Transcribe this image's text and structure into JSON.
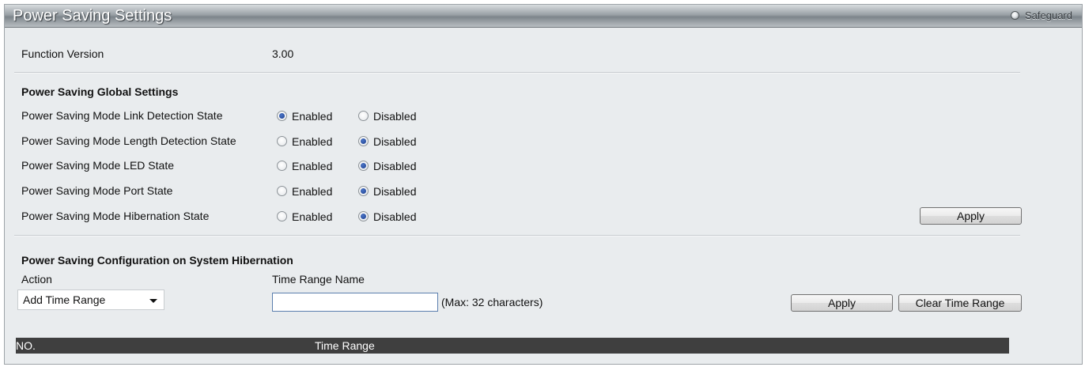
{
  "header": {
    "title": "Power Saving Settings",
    "safeguard_label": "Safeguard"
  },
  "function_version": {
    "label": "Function Version",
    "value": "3.00"
  },
  "global_settings": {
    "heading": "Power Saving Global Settings",
    "enabled_label": "Enabled",
    "disabled_label": "Disabled",
    "rows": [
      {
        "label": "Power Saving Mode Link Detection State",
        "selected": "Enabled"
      },
      {
        "label": "Power Saving Mode Length Detection State",
        "selected": "Disabled"
      },
      {
        "label": "Power Saving Mode LED State",
        "selected": "Disabled"
      },
      {
        "label": "Power Saving Mode Port State",
        "selected": "Disabled"
      },
      {
        "label": "Power Saving Mode Hibernation State",
        "selected": "Disabled"
      }
    ],
    "apply_label": "Apply"
  },
  "hibernation": {
    "heading": "Power Saving Configuration on System Hibernation",
    "action_label": "Action",
    "action_selected": "Add Time Range",
    "time_range_name_label": "Time Range Name",
    "time_range_name_value": "",
    "hint": "(Max: 32 characters)",
    "apply_label": "Apply",
    "clear_label": "Clear Time Range"
  },
  "table": {
    "columns": [
      "NO.",
      "Time Range"
    ]
  },
  "colors": {
    "panel_background": "#e9ecee",
    "table_header": "#3f3f3f",
    "radio_checked": "#1d3f8f"
  }
}
